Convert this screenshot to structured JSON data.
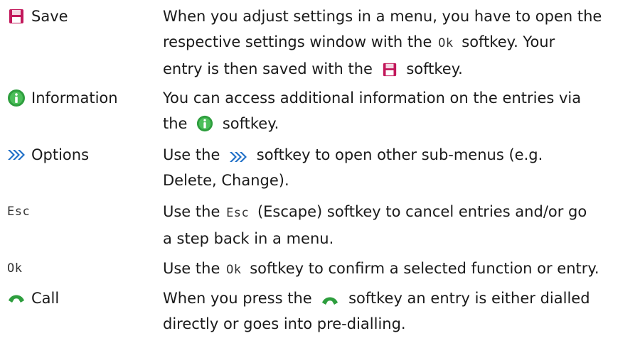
{
  "rows": [
    {
      "term": "Save",
      "icon": "save-icon",
      "desc_a": "When you adjust settings in a menu, you have to open the",
      "desc_b": "respective settings window with the",
      "key": "Ok",
      "desc_c": "softkey. Your",
      "desc_d": "entry is then saved with the",
      "desc_e": "softkey."
    },
    {
      "term": "Information",
      "icon": "info-icon",
      "desc_a": "You can access additional information on the entries via",
      "desc_b": "the",
      "desc_c": "softkey."
    },
    {
      "term": "Options",
      "icon": "options-icon",
      "desc_a": "Use the",
      "desc_b": "softkey to open other sub-menus (e.g.",
      "desc_c": "Delete, Change)."
    },
    {
      "term": "Esc",
      "desc_a": "Use the",
      "key": "Esc",
      "desc_b": "(Escape) softkey to cancel entries and/or go",
      "desc_c": "a step back in a menu."
    },
    {
      "term": "Ok",
      "desc_a": "Use the",
      "key": "Ok",
      "desc_b": "softkey to confirm a selected function or entry."
    },
    {
      "term": "Call",
      "icon": "call-icon",
      "desc_a": "When you press the",
      "desc_b": "softkey an entry is either dialled",
      "desc_c": "directly or goes into pre-dialling."
    }
  ],
  "colors": {
    "save_icon": "#c2185b",
    "info_icon": "#2e9e3e",
    "options_icon": "#1f6fc7",
    "call_icon": "#2e9e3e"
  }
}
